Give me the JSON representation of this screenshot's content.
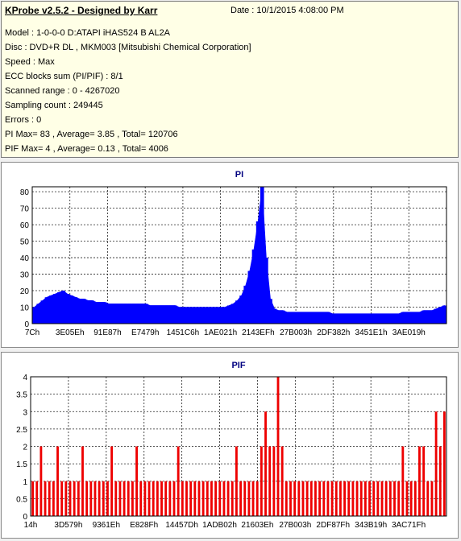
{
  "header": {
    "title": "KProbe v2.5.2 - Designed by Karr",
    "date": "Date :  10/1/2015 4:08:00 PM",
    "lines": [
      "Model : 1-0-0-0 D:ATAPI   iHAS524   B      AL2A",
      "Disc : DVD+R DL , MKM003 [Mitsubishi Chemical Corporation]",
      "Speed : Max",
      "ECC blocks sum (PI/PIF) : 8/1",
      "Scanned range : 0 - 4267020",
      "Sampling count : 249445",
      "Errors : 0",
      "PI Max= 83 , Average= 3.85 , Total= 120706",
      "PIF Max= 4 , Average= 0.13 , Total= 4006"
    ]
  },
  "colors": {
    "pi": "#0000ff",
    "pif": "#ee0000",
    "grid": "#222222",
    "title": "#000080"
  },
  "chart_data": [
    {
      "type": "area",
      "title": "PI",
      "xlabel": "",
      "ylabel": "",
      "ylim": [
        0,
        83
      ],
      "yticks": [
        "0",
        "10",
        "20",
        "30",
        "40",
        "50",
        "60",
        "70",
        "80"
      ],
      "xticks": [
        "7Ch",
        "3E05Eh",
        "91E87h",
        "E7479h",
        "1451C6h",
        "1AE021h",
        "2143EFh",
        "27B003h",
        "2DF382h",
        "3451E1h",
        "3AE019h"
      ],
      "grid": true,
      "series": [
        {
          "values": [
            10,
            12,
            14,
            16,
            17,
            18,
            19,
            20,
            18,
            17,
            16,
            15,
            15,
            14,
            14,
            13,
            13,
            13,
            12,
            12,
            12,
            12,
            12,
            12,
            12,
            12,
            12,
            12,
            11,
            11,
            11,
            11,
            11,
            11,
            11,
            10,
            10,
            10,
            10,
            10,
            10,
            10,
            10,
            10,
            10,
            10,
            10,
            11,
            12,
            14,
            17,
            23,
            32,
            45,
            62,
            83,
            40,
            15,
            9,
            8,
            8,
            7,
            7,
            7,
            7,
            7,
            7,
            7,
            7,
            7,
            7,
            7,
            6,
            6,
            6,
            6,
            6,
            6,
            6,
            6,
            6,
            6,
            6,
            6,
            6,
            6,
            6,
            6,
            6,
            7,
            7,
            7,
            7,
            7,
            8,
            8,
            8,
            9,
            10,
            11
          ]
        }
      ]
    },
    {
      "type": "bar",
      "title": "PIF",
      "xlabel": "",
      "ylabel": "",
      "ylim": [
        0,
        4
      ],
      "yticks": [
        "0",
        "0.5",
        "1",
        "1.5",
        "2",
        "2.5",
        "3",
        "3.5",
        "4"
      ],
      "xticks": [
        "14h",
        "3D579h",
        "9361Eh",
        "E828Fh",
        "14457Dh",
        "1ADB02h",
        "21603Eh",
        "27B003h",
        "2DF87Fh",
        "343B19h",
        "3AC71Fh"
      ],
      "grid": true,
      "series": [
        {
          "values": [
            1,
            1,
            2,
            1,
            1,
            1,
            2,
            1,
            1,
            1,
            1,
            1,
            2,
            1,
            1,
            1,
            1,
            1,
            1,
            2,
            1,
            1,
            1,
            1,
            1,
            2,
            1,
            1,
            1,
            1,
            1,
            1,
            1,
            1,
            1,
            2,
            1,
            1,
            1,
            1,
            1,
            1,
            1,
            1,
            1,
            1,
            1,
            1,
            1,
            2,
            1,
            1,
            1,
            1,
            1,
            2,
            3,
            2,
            2,
            4,
            2,
            1,
            1,
            1,
            1,
            1,
            1,
            1,
            1,
            1,
            1,
            1,
            1,
            1,
            1,
            1,
            1,
            1,
            1,
            1,
            1,
            1,
            1,
            1,
            1,
            1,
            1,
            1,
            1,
            2,
            1,
            1,
            1,
            2,
            2,
            1,
            1,
            3,
            2,
            3
          ]
        }
      ]
    }
  ]
}
